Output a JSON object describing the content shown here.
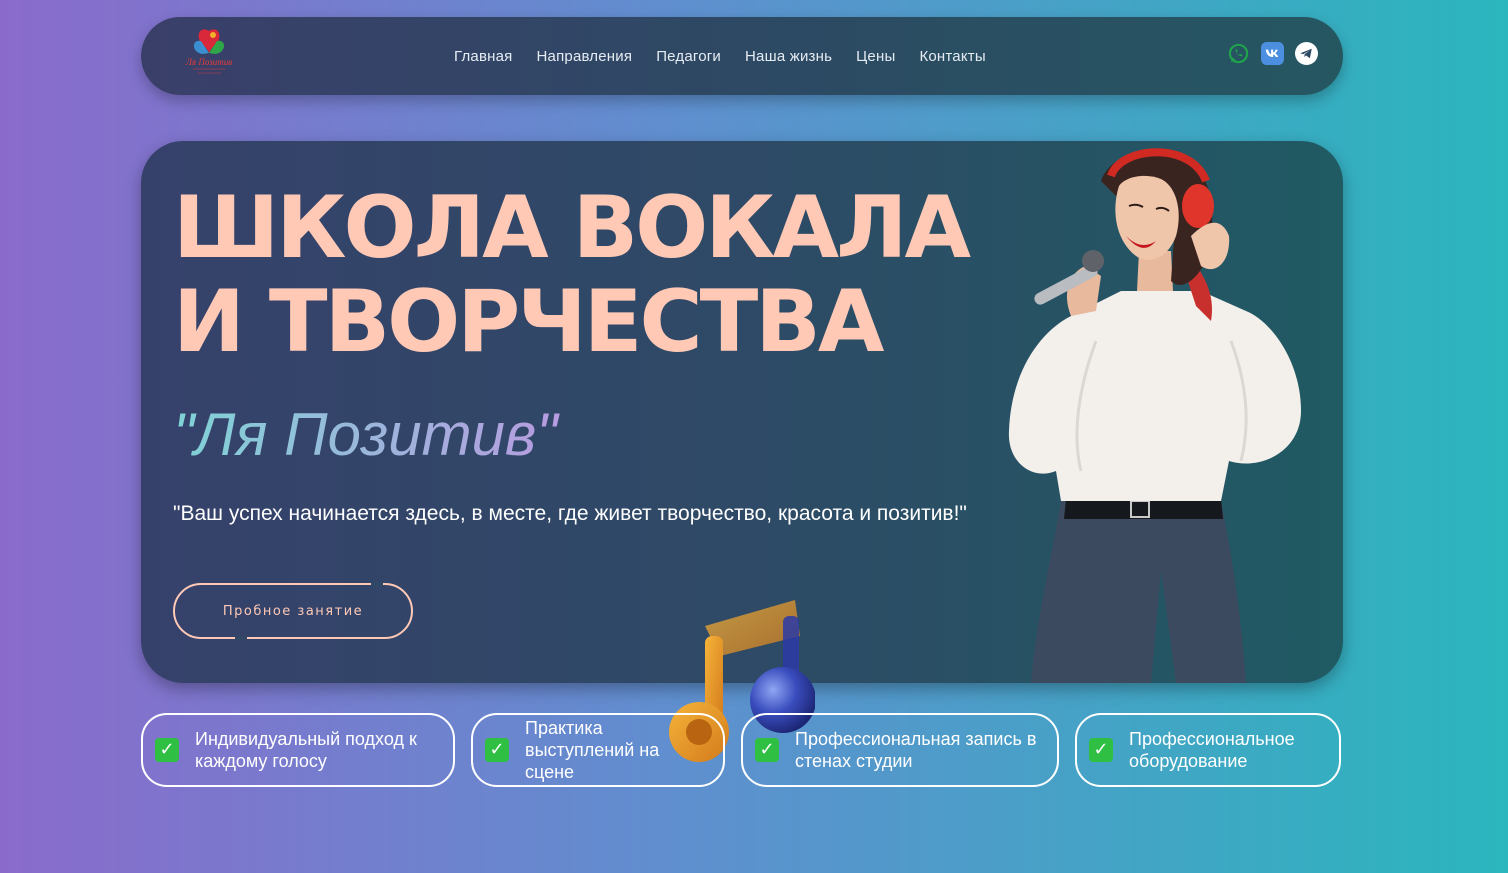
{
  "header": {
    "logo_text": "Ля Позитив",
    "nav": [
      {
        "label": "Главная"
      },
      {
        "label": "Направления"
      },
      {
        "label": "Педагоги"
      },
      {
        "label": "Наша жизнь"
      },
      {
        "label": "Цены"
      },
      {
        "label": "Контакты"
      }
    ],
    "socials": [
      {
        "icon": "whatsapp-icon",
        "color": "#1ea44a"
      },
      {
        "icon": "vk-icon",
        "color": "#4c8fe0"
      },
      {
        "icon": "telegram-icon",
        "color": "#ffffff"
      }
    ]
  },
  "hero": {
    "title_line1": "ШКОЛА ВОКАЛА",
    "title_line2": "И ТВОРЧЕСТВА",
    "brand": "\"Ля Позитив\"",
    "tagline": "\"Ваш успех начинается здесь, в месте, где живет творчество, красота и позитив!\"",
    "cta_label": "Пробное занятие"
  },
  "features": [
    {
      "text": "Индивидуальный подход к каждому голосу"
    },
    {
      "text": "Практика выступлений на сцене"
    },
    {
      "text": "Профессиональная запись в стенах студии"
    },
    {
      "text": "Профессиональное оборудование"
    }
  ],
  "colors": {
    "accent": "#ffc9b6",
    "brand_gradient_start": "#7fc7df",
    "brand_gradient_end": "#b79be0",
    "check": "#2fc043"
  }
}
